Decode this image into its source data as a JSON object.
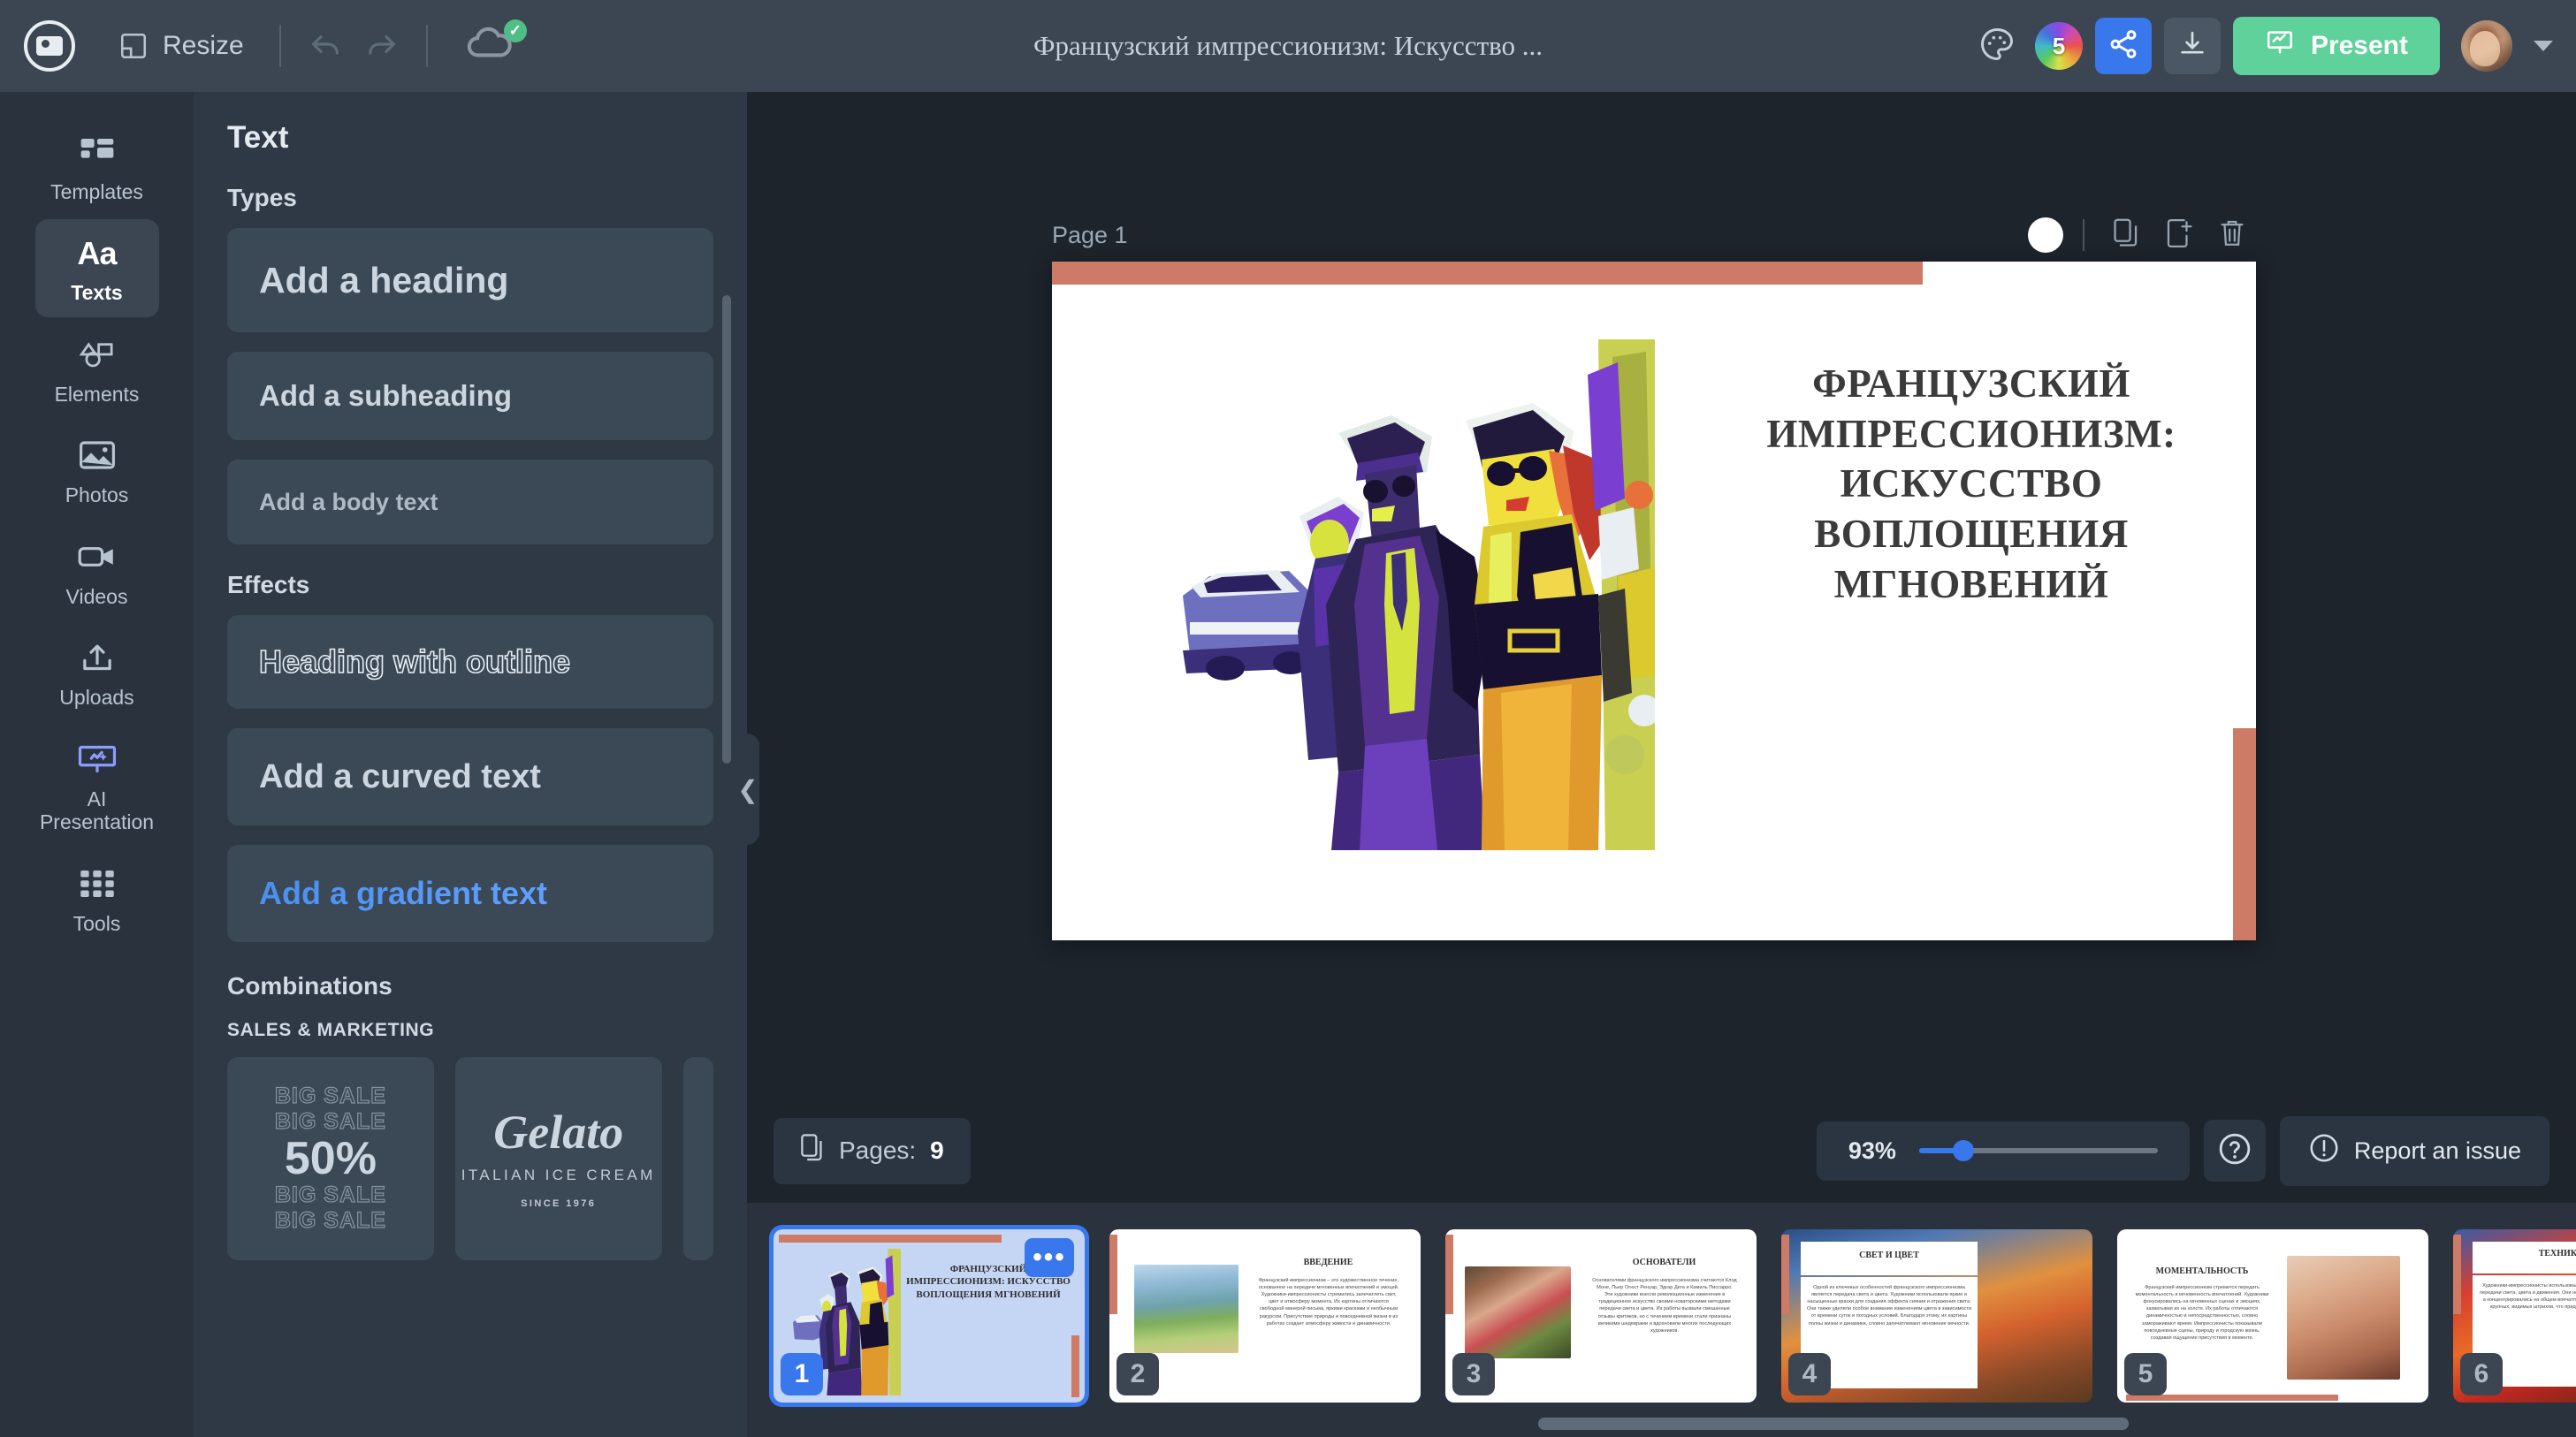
{
  "topbar": {
    "logo_icon": "app-logo-icon",
    "resize_label": "Resize",
    "undo_icon": "undo-icon",
    "redo_icon": "redo-icon",
    "cloud_icon": "cloud-saved-icon",
    "cloud_check": "✓",
    "document_title": "Французский импрессионизм: Искусство ...",
    "palette_icon": "palette-icon",
    "color_wheel_badge": "5",
    "share_icon": "share-icon",
    "download_icon": "download-icon",
    "present_label": "Present",
    "present_icon": "present-screen-icon",
    "avatar_icon": "user-avatar",
    "account_caret": "chevron-down-icon"
  },
  "sidebar": {
    "items": [
      {
        "label": "Templates",
        "icon": "templates-icon",
        "active": false
      },
      {
        "label": "Texts",
        "icon": "text-aa-icon",
        "active": true
      },
      {
        "label": "Elements",
        "icon": "elements-shapes-icon",
        "active": false
      },
      {
        "label": "Photos",
        "icon": "photo-icon",
        "active": false
      },
      {
        "label": "Videos",
        "icon": "video-camera-icon",
        "active": false
      },
      {
        "label": "Uploads",
        "icon": "upload-icon",
        "active": false
      },
      {
        "label": "AI Presentation",
        "icon": "ai-presentation-icon",
        "active": false
      },
      {
        "label": "Tools",
        "icon": "grid-tools-icon",
        "active": false
      }
    ]
  },
  "panel": {
    "title": "Text",
    "types_heading": "Types",
    "types": [
      {
        "label": "Add a heading",
        "style": "heading"
      },
      {
        "label": "Add a subheading",
        "style": "subheading"
      },
      {
        "label": "Add a body text",
        "style": "body"
      }
    ],
    "effects_heading": "Effects",
    "effects": [
      {
        "label": "Heading with outline",
        "style": "outline"
      },
      {
        "label": "Add a curved text",
        "style": "curved"
      },
      {
        "label": "Add a gradient text",
        "style": "gradient"
      }
    ],
    "combinations_heading": "Combinations",
    "combinations_category": "SALES & MARKETING",
    "combination_cards": [
      {
        "ghost_top_1": "BIG SALE",
        "ghost_top_2": "BIG SALE",
        "big": "50%",
        "ghost_bottom_1": "BIG SALE",
        "ghost_bottom_2": "BIG SALE"
      },
      {
        "name": "Gelato",
        "tagline": "ITALIAN ICE CREAM",
        "since": "SINCE 1976"
      }
    ],
    "collapse_icon": "chevron-left-icon"
  },
  "canvas": {
    "page_label": "Page 1",
    "page_color_swatch": "#ffffff",
    "tools": [
      {
        "icon": "copy-page-icon",
        "name": "duplicate-page"
      },
      {
        "icon": "add-page-icon",
        "name": "add-page"
      },
      {
        "icon": "trash-icon",
        "name": "delete-page"
      }
    ],
    "slide": {
      "accent_color": "#cd7b66",
      "background": "#ffffff",
      "title": "ФРАНЦУЗСКИЙ ИМПРЕССИОНИЗМ: ИСКУССТВО ВОПЛОЩЕНИЯ МГНОВЕНИЙ",
      "artwork_name": "impressionist-street-figures-artwork"
    }
  },
  "bottombar": {
    "pages_label": "Pages:",
    "pages_count": "9",
    "pages_icon": "pages-icon",
    "zoom_percent": "93%",
    "zoom_value": 93,
    "help_icon": "help-question-icon",
    "report_icon": "alert-circle-icon",
    "report_label": "Report an issue"
  },
  "thumbnails": [
    {
      "number": "1",
      "title": "ФРАНЦУЗСКИЙ ИМПРЕССИОНИЗМ: ИСКУССТВО ВОПЛОЩЕНИЯ МГНОВЕНИЙ",
      "selected": true,
      "menu_icon": "more-options-icon",
      "menu_glyph": "•••"
    },
    {
      "number": "2",
      "title": "ВВЕДЕНИЕ",
      "body": "Французский импрессионизм – это художественное течение, основанное на передаче мгновенных впечатлений и эмоций. Художники-импрессионисты стремились запечатлеть свет, цвет и атмосферу момента. Их картины отличаются свободной манерой письма, яркими красками и необычным ракурсом. Присутствие природы и повседневной жизни в их работах создает атмосферу живости и динамичности.",
      "selected": false
    },
    {
      "number": "3",
      "title": "ОСНОВАТЕЛИ",
      "body": "Основателями французского импрессионизма считаются Клод Моне, Пьер Огюст Ренуар, Эдгар Дега и Камиль Писсарро. Эти художники внесли революционные изменения в традиционное искусство своими новаторскими методами передачи света и цвета. Их работы вызвали смешанные отзывы критиков, но с течением времени стали признаны великими шедеврами и вдохновили многих последующих художников.",
      "selected": false
    },
    {
      "number": "4",
      "title": "СВЕТ И ЦВЕТ",
      "body": "Одной из ключевых особенностей французского импрессионизма является передача света и цвета. Художники использовали яркие и насыщенные краски для создания эффекта сияния и отражения света. Они также уделяли особое внимание изменениям цвета в зависимости от времени суток и погодных условий. Благодаря этому, их картины полны жизни и динамики, словно запечатлевают мгновение вечности.",
      "selected": false
    },
    {
      "number": "5",
      "title": "МОМЕНТАЛЬНОСТЬ",
      "body": "Французский импрессионизм стремится передать моментальность и мгновенность впечатлений. Художники фокусировались на мгновенных сценах и эмоциях, захватывая их на холсте. Их работы отличаются динамичностью и непосредственностью, словно замораживают время. Импрессионисты показывали повседневные сцены, природу и городскую жизнь, создавая ощущение присутствия в моменте.",
      "selected": false
    },
    {
      "number": "6",
      "title": "ТЕХНИКА",
      "body": "Художники-импрессионисты использовали новаторские техники для передачи света, цвета и движения. Они не стремились к детализации, а концентрировались на общем впечатлении. Их мазки состояли из крупных, видимых штрихов, что придавало работам живость.",
      "selected": false
    }
  ]
}
